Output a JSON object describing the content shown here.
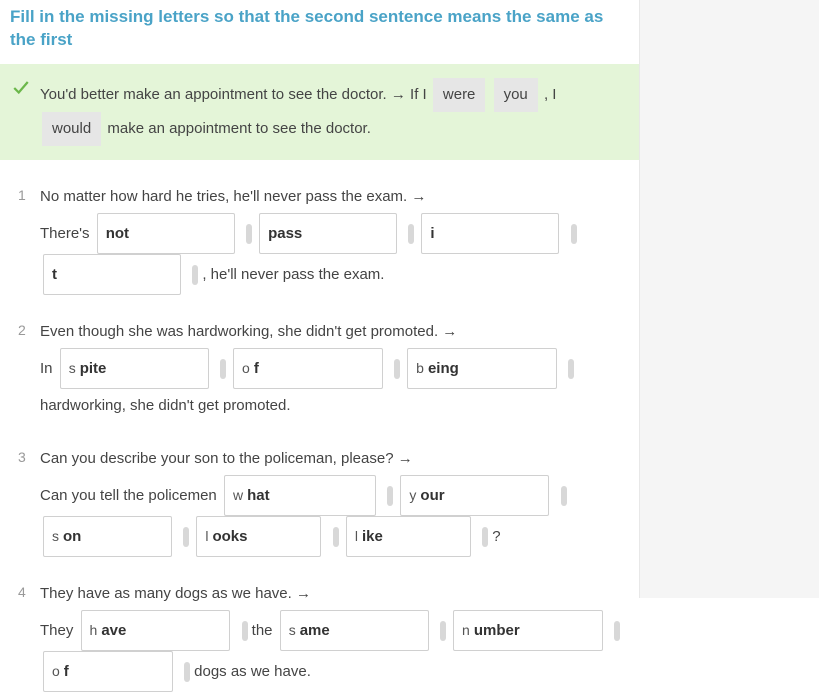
{
  "instructions": "Fill in the missing letters so that the second sentence means the same as the first",
  "example": {
    "pre": "You'd better make an appointment to see the doctor. → If I",
    "box1": "were",
    "box2": "you",
    "mid": ", I",
    "box3": "would",
    "post": "make an appointment to see the doctor."
  },
  "questions": [
    {
      "num": "1",
      "prompt": "No matter how hard he tries, he'll never pass the exam. →",
      "line2_pre": "There's",
      "inputs_line2": [
        {
          "prefix": "",
          "val": "not",
          "w": "wide"
        },
        {
          "prefix": "",
          "val": "pass",
          "w": "wide"
        },
        {
          "prefix": "",
          "val": "i",
          "w": "wide"
        }
      ],
      "line3_inputs": [
        {
          "prefix": "",
          "val": "t",
          "w": "wide"
        }
      ],
      "line3_post": ", he'll never pass the exam."
    },
    {
      "num": "2",
      "prompt": "Even though she was hardworking, she didn't get promoted. →",
      "line2_pre": "In",
      "inputs_line2": [
        {
          "prefix": "s",
          "val": "pite",
          "w": "wide"
        },
        {
          "prefix": "o",
          "val": "f",
          "w": "wide"
        },
        {
          "prefix": "b",
          "val": "eing",
          "w": "wide"
        }
      ],
      "line3_post": "hardworking, she didn't get promoted."
    },
    {
      "num": "3",
      "prompt": "Can you describe your son to the policeman, please? →",
      "line2_pre": "Can you tell the policemen",
      "inputs_line2": [
        {
          "prefix": "w",
          "val": "hat",
          "w": "wide"
        },
        {
          "prefix": "y",
          "val": "our",
          "w": "wide"
        }
      ],
      "line3_inputs": [
        {
          "prefix": "s",
          "val": "on",
          "w": "med"
        },
        {
          "prefix": "l",
          "val": "ooks",
          "w": "med"
        },
        {
          "prefix": "l",
          "val": "ike",
          "w": "med"
        }
      ],
      "line3_post": "?"
    },
    {
      "num": "4",
      "prompt": "They have as many dogs as we have. →",
      "line2_pre": "They",
      "inputs_line2": [
        {
          "prefix": "h",
          "val": "ave",
          "w": "wide"
        }
      ],
      "line2_mid": "the",
      "inputs_line2b": [
        {
          "prefix": "s",
          "val": "ame",
          "w": "wide"
        },
        {
          "prefix": "n",
          "val": "umber",
          "w": "wide"
        }
      ],
      "line3_inputs": [
        {
          "prefix": "o",
          "val": "f",
          "w": "med"
        }
      ],
      "line3_post": "dogs as we have."
    }
  ]
}
